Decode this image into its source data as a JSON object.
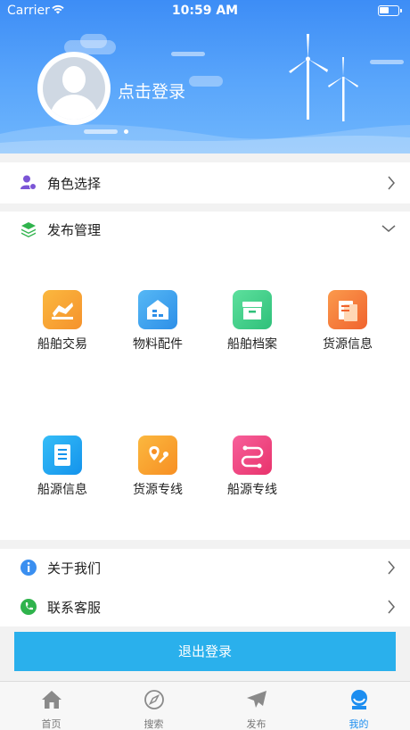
{
  "status_bar": {
    "carrier": "Carrier",
    "time": "10:59 AM"
  },
  "profile": {
    "login_prompt": "点击登录"
  },
  "menu": {
    "role_select": {
      "label": "角色选择",
      "icon": "user-role-icon"
    },
    "publish_manage": {
      "label": "发布管理",
      "icon": "layers-icon"
    },
    "about_us": {
      "label": "关于我们",
      "icon": "info-icon"
    },
    "contact_service": {
      "label": "联系客服",
      "icon": "phone-icon"
    }
  },
  "publish_items": [
    {
      "label": "船舶交易",
      "icon": "handshake-icon",
      "color": "#f7a234"
    },
    {
      "label": "物料配件",
      "icon": "warehouse-icon",
      "color": "#3aa3f0"
    },
    {
      "label": "船舶档案",
      "icon": "archive-box-icon",
      "color": "#3ccf84"
    },
    {
      "label": "货源信息",
      "icon": "document-icon",
      "color": "#f5773c"
    },
    {
      "label": "船源信息",
      "icon": "list-document-icon",
      "color": "#1da9f2"
    },
    {
      "label": "货源专线",
      "icon": "map-pin-icon",
      "color": "#f7a234"
    },
    {
      "label": "船源专线",
      "icon": "route-icon",
      "color": "#f0457e"
    }
  ],
  "logout_label": "退出登录",
  "tabbar": [
    {
      "label": "首页",
      "icon": "home-icon",
      "active": false
    },
    {
      "label": "搜索",
      "icon": "compass-icon",
      "active": false
    },
    {
      "label": "发布",
      "icon": "send-icon",
      "active": false
    },
    {
      "label": "我的",
      "icon": "profile-icon",
      "active": true
    }
  ],
  "colors": {
    "accent": "#2ab0ec",
    "header": "#4a98f8",
    "tab_active": "#1d8ef0"
  }
}
